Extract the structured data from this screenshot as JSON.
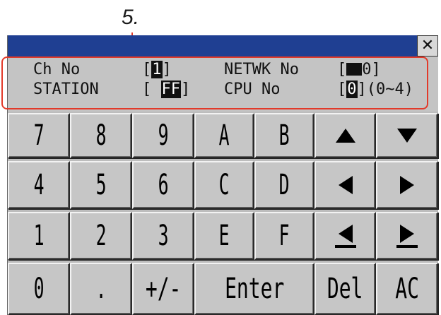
{
  "callout": {
    "label": "5."
  },
  "window": {
    "close_icon": "close-icon",
    "close_glyph": "✕"
  },
  "info": {
    "ch_no_label": "Ch No",
    "ch_no_value": "1",
    "station_label": "STATION",
    "station_value": "FF",
    "netwk_no_label": "NETWK No",
    "netwk_no_value": "0",
    "cpu_no_label": "CPU No",
    "cpu_no_value": "0",
    "cpu_no_range": "(0~4)"
  },
  "keys": {
    "row1": [
      "7",
      "8",
      "9",
      "A",
      "B"
    ],
    "row2": [
      "4",
      "5",
      "6",
      "C",
      "D"
    ],
    "row3": [
      "1",
      "2",
      "3",
      "E",
      "F"
    ],
    "row4": [
      "0",
      ".",
      "+/-",
      "Enter",
      "Del",
      "AC"
    ],
    "arrows": {
      "up": "arrow-up-icon",
      "down": "arrow-down-icon",
      "left": "arrow-left-icon",
      "right": "arrow-right-icon",
      "cursor_left": "cursor-left-icon",
      "cursor_right": "cursor-right-icon"
    }
  },
  "colors": {
    "titlebar": "#1f3f92",
    "callout": "#e23a2a",
    "panel": "#bdbdbd"
  }
}
